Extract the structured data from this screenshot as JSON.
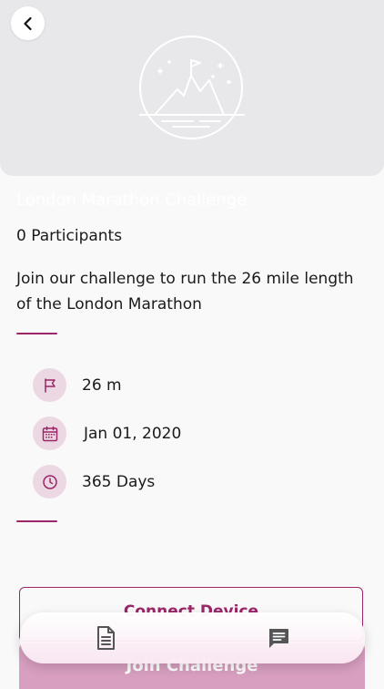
{
  "header": {
    "back_icon": "chevron-left-icon",
    "hero_icon": "mountain-flag-icon"
  },
  "challenge": {
    "title": "London Marathon Challenge",
    "participants": "0 Participants",
    "description": "Join our challenge to run the 26 mile length of the London Marathon"
  },
  "details": [
    {
      "icon": "flag-icon",
      "text": "26 m"
    },
    {
      "icon": "calendar-icon",
      "text": "Jan 01, 2020"
    },
    {
      "icon": "clock-icon",
      "text": "365 Days"
    }
  ],
  "actions": {
    "connect_label": "Connect Device",
    "join_label": "Join Challenge"
  },
  "nav": {
    "items": [
      {
        "icon": "document-icon"
      },
      {
        "icon": "chat-icon"
      }
    ]
  },
  "colors": {
    "accent": "#9b2668",
    "icon_bg": "#ecd8e3",
    "join_bg": "#d89fc0",
    "hero_bg": "#e8e8ea"
  }
}
